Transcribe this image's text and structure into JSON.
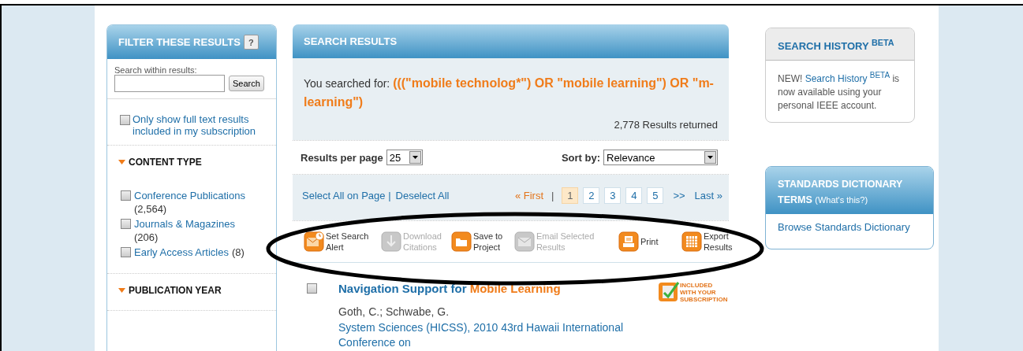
{
  "filter": {
    "title": "FILTER THESE RESULTS",
    "help": "?",
    "search_label": "Search within results:",
    "search_button": "Search",
    "full_text": {
      "label": "Only show full text results included in my subscription",
      "checked": false
    },
    "sections": [
      {
        "title": "CONTENT TYPE",
        "expanded": true,
        "items": [
          {
            "label": "Conference Publications",
            "count": "(2,564)",
            "checked": false
          },
          {
            "label": "Journals & Magazines",
            "count": "(206)",
            "checked": false
          },
          {
            "label": "Early Access Articles",
            "count": "(8)",
            "checked": false
          }
        ]
      },
      {
        "title": "PUBLICATION YEAR",
        "expanded": true
      }
    ]
  },
  "results": {
    "title": "SEARCH RESULTS",
    "query_prefix": "You searched for:",
    "query": "(((\"mobile technolog*\") OR \"mobile learning\") OR \"m-learning\")",
    "count_text": "2,778 Results returned",
    "per_page_label": "Results per page",
    "per_page": "25",
    "sort_label": "Sort by:",
    "sort": "Relevance",
    "select_all": "Select All on Page |",
    "deselect_all": "Deselect All",
    "pagination": {
      "first": "« First",
      "separator": "|",
      "pages": [
        {
          "label": "1",
          "selected": true
        },
        {
          "label": "2",
          "selected": false
        },
        {
          "label": "3",
          "selected": false
        },
        {
          "label": "4",
          "selected": false
        },
        {
          "label": "5",
          "selected": false
        }
      ],
      "next": ">>",
      "last": "Last »"
    },
    "actions": [
      {
        "kind": "alert",
        "label": "Set Search Alert",
        "disabled": false
      },
      {
        "kind": "download",
        "label": "Download Citations",
        "disabled": true
      },
      {
        "kind": "save",
        "label": "Save to Project",
        "disabled": false
      },
      {
        "kind": "email",
        "label": "Email Selected Results",
        "disabled": true
      },
      {
        "kind": "print",
        "label": "Print",
        "disabled": false
      },
      {
        "kind": "export",
        "label": "Export Results",
        "disabled": false
      }
    ],
    "items": [
      {
        "checked": false,
        "title_parts": [
          {
            "text": "Navigation Support for ",
            "highlighted": false
          },
          {
            "text": "Mobile Learning",
            "highlighted": true
          }
        ],
        "badge": "INCLUDED WITH YOUR SUBSCRIPTION",
        "authors": "Goth, C.; Schwabe, G.",
        "publication": "System Sciences (HICSS), 2010 43rd Hawaii International Conference on"
      }
    ]
  },
  "search_history": {
    "title": "SEARCH HISTORY $^{BETA}$",
    "prefix": "NEW!",
    "link": "Search History $^{BETA}$",
    "text": "is now available using your personal IEEE account."
  },
  "standards": {
    "title": "STANDARDS DICTIONARY TERMS",
    "whats_this": "(What's this?)",
    "link": "Browse Standards Dictionary"
  },
  "annotation": {
    "kind": "ellipse"
  }
}
